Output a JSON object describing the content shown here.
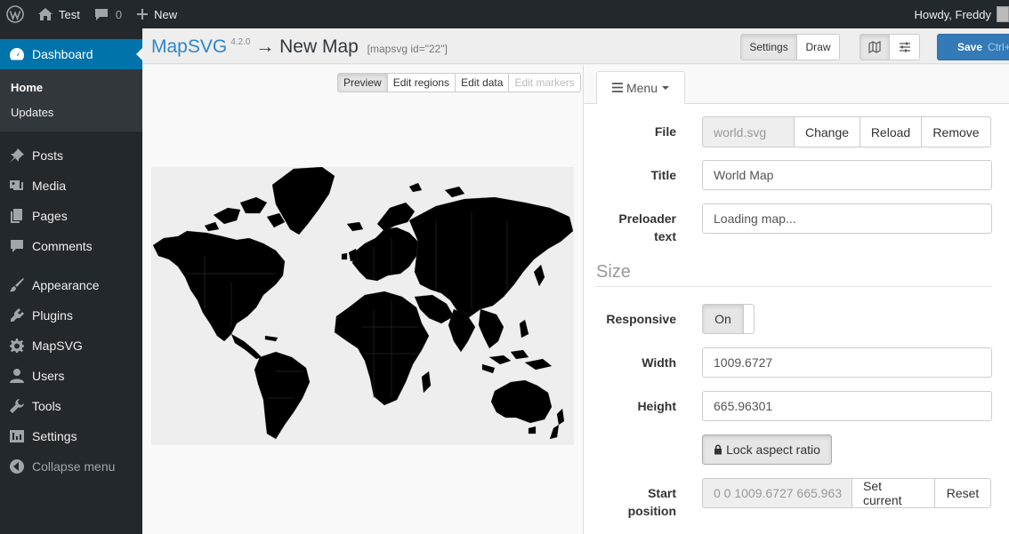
{
  "adminbar": {
    "site_name": "Test",
    "comments_count": "0",
    "new_label": "New",
    "howdy": "Howdy, Freddy"
  },
  "sidebar": {
    "current": "Dashboard",
    "submenu": [
      "Home",
      "Updates"
    ],
    "items": [
      {
        "label": "Posts",
        "icon": "pin-icon"
      },
      {
        "label": "Media",
        "icon": "media-icon"
      },
      {
        "label": "Pages",
        "icon": "pages-icon"
      },
      {
        "label": "Comments",
        "icon": "comment-icon"
      },
      {
        "label": "Appearance",
        "icon": "brush-icon"
      },
      {
        "label": "Plugins",
        "icon": "plugin-icon"
      },
      {
        "label": "MapSVG",
        "icon": "gear-icon"
      },
      {
        "label": "Users",
        "icon": "user-icon"
      },
      {
        "label": "Tools",
        "icon": "wrench-icon"
      },
      {
        "label": "Settings",
        "icon": "settings-icon"
      }
    ],
    "collapse_label": "Collapse menu"
  },
  "header": {
    "brand": "MapSVG",
    "version": "4.2.0",
    "title": "→ New Map",
    "shortcode": "[mapsvg id=\"22\"]",
    "mode_buttons": [
      "Settings",
      "Draw"
    ],
    "save_label": "Save",
    "save_shortcut": "Ctrl+S"
  },
  "map": {
    "modes": [
      "Preview",
      "Edit regions",
      "Edit data",
      "Edit markers"
    ]
  },
  "settings": {
    "menu_tab": "Menu",
    "file": {
      "label": "File",
      "value": "world.svg",
      "buttons": [
        "Change",
        "Reload",
        "Remove"
      ]
    },
    "title": {
      "label": "Title",
      "value": "World Map"
    },
    "preloader": {
      "label_line1": "Preloader",
      "label_line2": "text",
      "value": "Loading map..."
    },
    "size_section": "Size",
    "responsive": {
      "label": "Responsive",
      "value": "On"
    },
    "width": {
      "label": "Width",
      "value": "1009.6727"
    },
    "height": {
      "label": "Height",
      "value": "665.96301"
    },
    "lock_label": "Lock aspect ratio",
    "start_position": {
      "label_line1": "Start",
      "label_line2": "position",
      "value": "0 0 1009.6727 665.963",
      "buttons": [
        "Set current",
        "Reset"
      ]
    }
  }
}
